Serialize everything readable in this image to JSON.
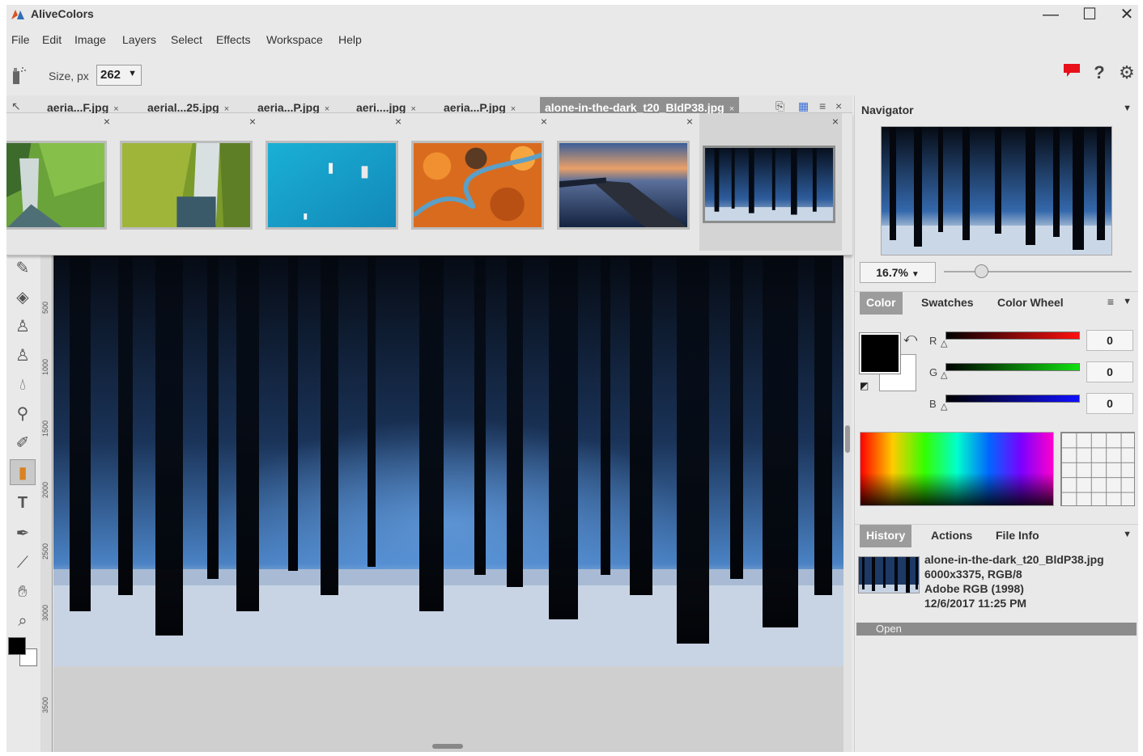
{
  "app": {
    "title": "AliveColors"
  },
  "window_controls": {
    "minimize": "—",
    "maximize": "☐",
    "close": "✕"
  },
  "menu": [
    "File",
    "Edit",
    "Image",
    "Layers",
    "Select",
    "Effects",
    "Workspace",
    "Help"
  ],
  "options_bar": {
    "size_label": "Size, px",
    "size_value": "262",
    "help_glyph": "?"
  },
  "tabs": [
    {
      "label": "aeria...F.jpg"
    },
    {
      "label": "aerial...25.jpg"
    },
    {
      "label": "aeria...P.jpg"
    },
    {
      "label": "aeri....jpg"
    },
    {
      "label": "aeria...P.jpg"
    },
    {
      "label": "alone-in-the-dark_t20_BldP38.jpg",
      "active": true
    }
  ],
  "thumbnails": [
    {
      "name": "waterfall-valley",
      "selected": false
    },
    {
      "name": "waterfall-aerial",
      "selected": false
    },
    {
      "name": "turquoise-sea-boats",
      "selected": false
    },
    {
      "name": "autumn-road",
      "selected": false
    },
    {
      "name": "bridge-sunset",
      "selected": false
    },
    {
      "name": "dark-forest",
      "selected": true
    }
  ],
  "ruler": {
    "labels": [
      "500",
      "1000",
      "1500",
      "2000",
      "2500",
      "3000",
      "3500"
    ]
  },
  "navigator": {
    "title": "Navigator",
    "zoom": "16.7%",
    "zoom_level": 0.167
  },
  "color_panel": {
    "tabs": [
      "Color",
      "Swatches",
      "Color Wheel"
    ],
    "active_tab": "Color",
    "channels": [
      {
        "label": "R",
        "value": "0",
        "color": "#ff1010"
      },
      {
        "label": "G",
        "value": "0",
        "color": "#10e010"
      },
      {
        "label": "B",
        "value": "0",
        "color": "#1010ff"
      }
    ],
    "foreground": "#000000",
    "background": "#ffffff"
  },
  "history_panel": {
    "tabs": [
      "History",
      "Actions",
      "File Info"
    ],
    "active_tab": "History",
    "file_name": "alone-in-the-dark_t20_BldP38.jpg",
    "dimensions": "6000x3375, RGB/8",
    "profile": "Adobe RGB (1998)",
    "date": "12/6/2017 11:25 PM",
    "entry": "Open"
  },
  "accent": {
    "selection": "#8f8f8f",
    "flag": "#e8101a"
  }
}
